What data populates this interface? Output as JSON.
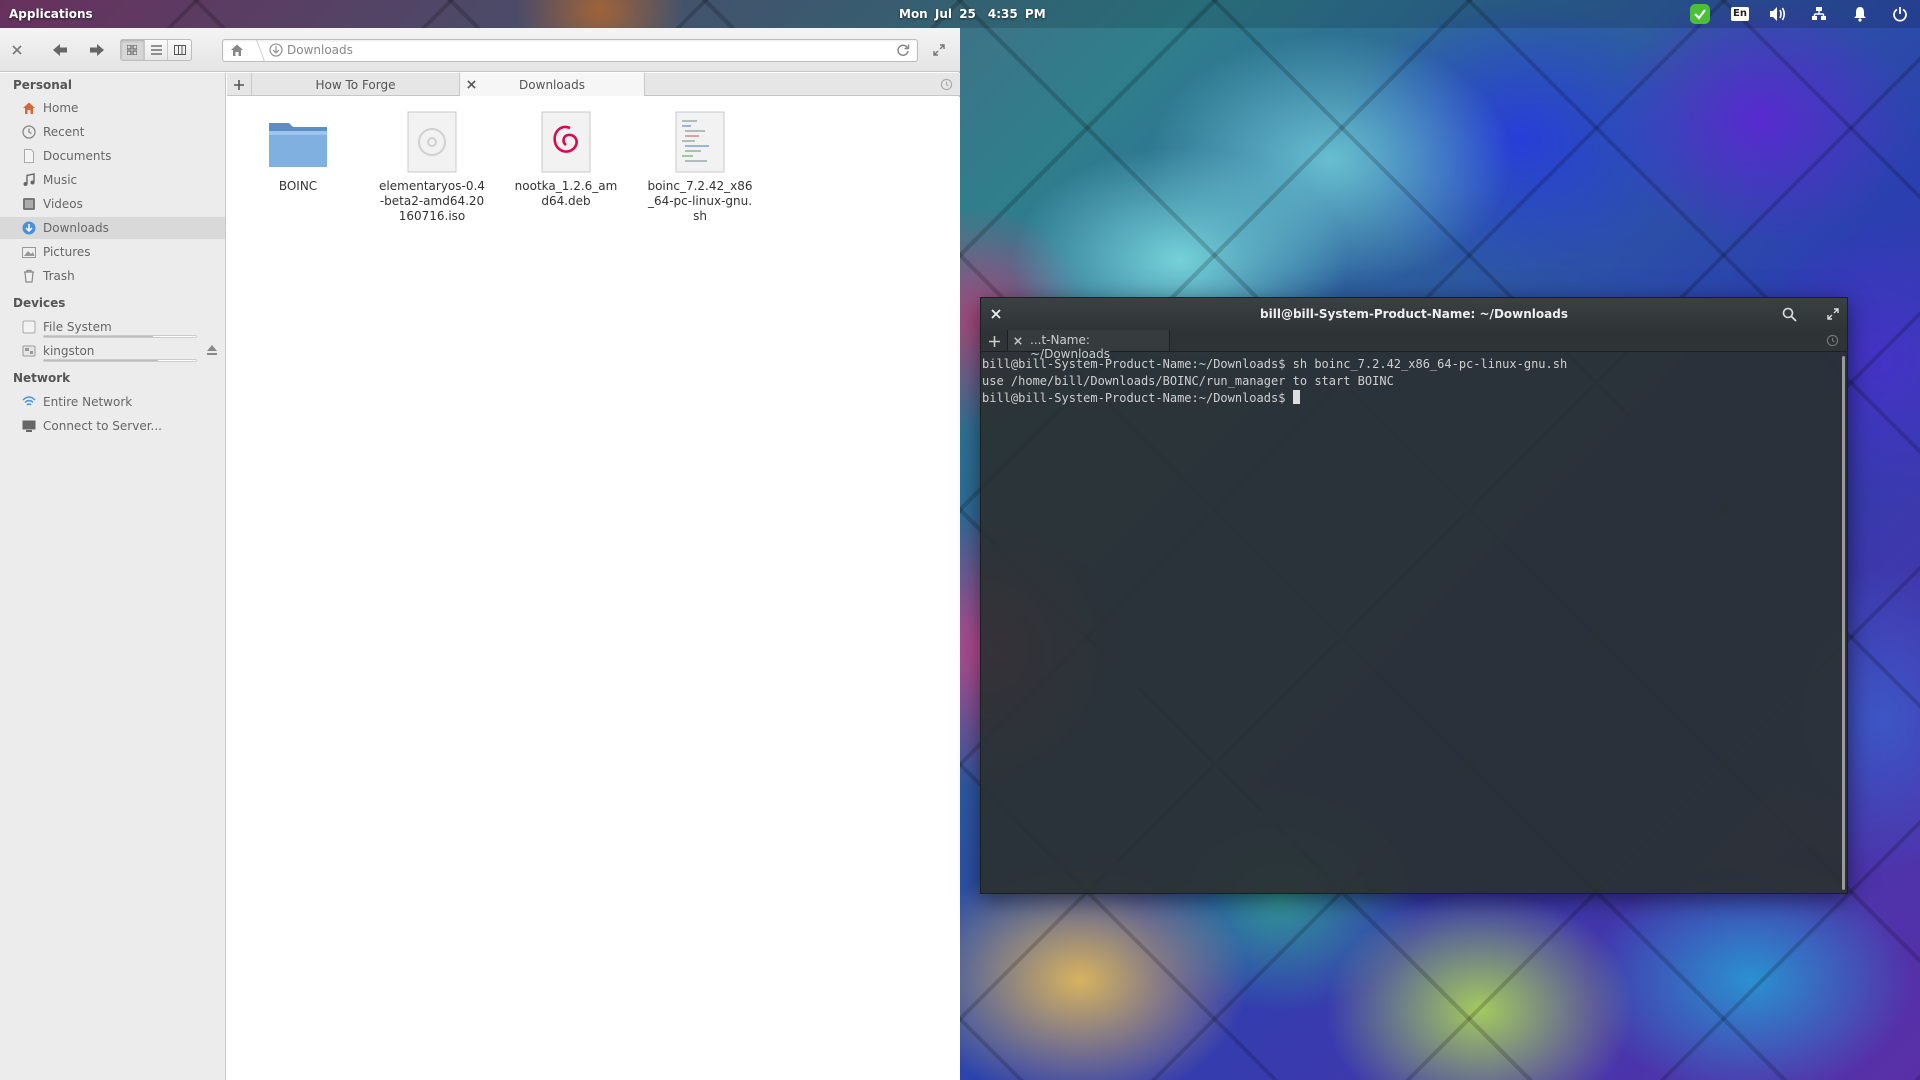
{
  "panel": {
    "applications_label": "Applications",
    "date": "Mon Jul 25",
    "time": "4:35 PM",
    "keyboard_layout": "En",
    "indicator_names": [
      "check-icon",
      "keyboard-icon",
      "volume-icon",
      "network-icon",
      "bell-icon",
      "power-icon"
    ]
  },
  "files": {
    "path_location": "Downloads",
    "sidebar": {
      "personal_header": "Personal",
      "personal": [
        {
          "label": "Home",
          "icon": "home-icon"
        },
        {
          "label": "Recent",
          "icon": "recent-icon"
        },
        {
          "label": "Documents",
          "icon": "documents-icon"
        },
        {
          "label": "Music",
          "icon": "music-icon"
        },
        {
          "label": "Videos",
          "icon": "videos-icon"
        },
        {
          "label": "Downloads",
          "icon": "downloads-icon",
          "selected": true
        },
        {
          "label": "Pictures",
          "icon": "pictures-icon"
        },
        {
          "label": "Trash",
          "icon": "trash-icon"
        }
      ],
      "devices_header": "Devices",
      "devices": [
        {
          "label": "File System",
          "icon": "drive-icon",
          "usage": 0.72
        },
        {
          "label": "kingston",
          "icon": "usb-drive-icon",
          "usage": 0.75
        }
      ],
      "network_header": "Network",
      "network": [
        {
          "label": "Entire Network",
          "icon": "network-icon"
        },
        {
          "label": "Connect to Server...",
          "icon": "server-icon"
        }
      ]
    },
    "tabs": [
      {
        "label": "How To Forge"
      },
      {
        "label": "Downloads"
      }
    ],
    "items": [
      {
        "name": "BOINC",
        "type": "folder"
      },
      {
        "name": "elementaryos-0.4-beta2-amd64.20160716.iso",
        "type": "disc-image"
      },
      {
        "name": "nootka_1.2.6_amd64.deb",
        "type": "debian-package"
      },
      {
        "name": "boinc_7.2.42_x86_64-pc-linux-gnu.sh",
        "type": "shell-script"
      }
    ]
  },
  "terminal": {
    "title": "bill@bill-System-Product-Name: ~/Downloads",
    "tab_label": "...t-Name: ~/Downloads",
    "lines": [
      "bill@bill-System-Product-Name:~/Downloads$ sh boinc_7.2.42_x86_64-pc-linux-gnu.sh",
      "use /home/bill/Downloads/BOINC/run_manager to start BOINC",
      "bill@bill-System-Product-Name:~/Downloads$ "
    ]
  },
  "colors": {
    "terminal_bg": "#2a3032",
    "sidebar_bg": "#ececec",
    "selection": "#d9d9d9",
    "indicator_green": "#4cbf38"
  }
}
